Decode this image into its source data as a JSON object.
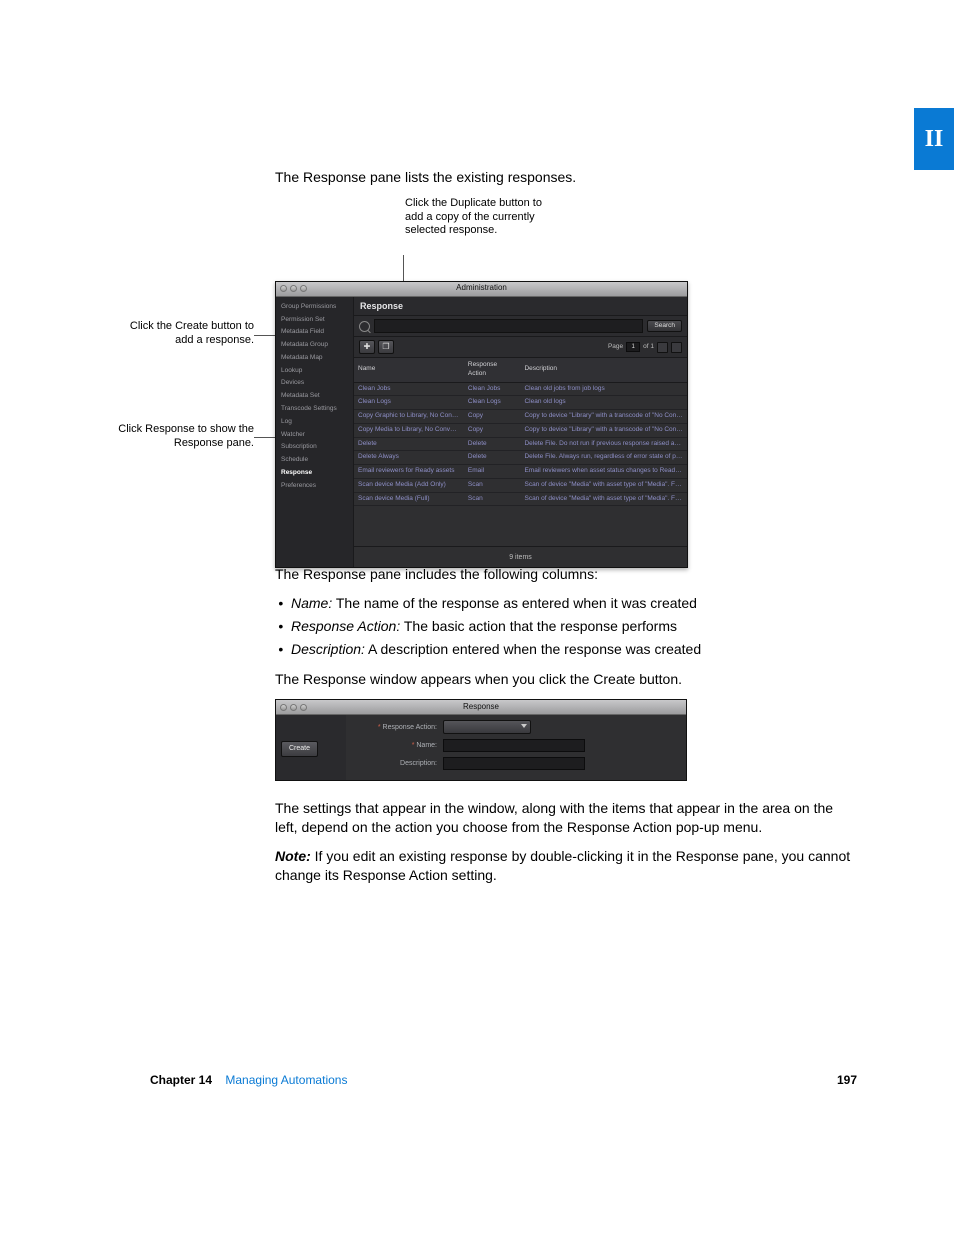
{
  "tab_marker": "II",
  "intro": "The Response pane lists the existing responses.",
  "callouts": {
    "duplicate": "Click the Duplicate button to add a copy of the currently selected response.",
    "create": "Click the Create button to add a response.",
    "response_pane": "Click Response to show the Response pane."
  },
  "admin_window": {
    "title": "Administration",
    "sidebar": {
      "items": [
        "Group Permissions",
        "Permission Set",
        "Metadata Field",
        "Metadata Group",
        "Metadata Map",
        "Lookup",
        "Devices",
        "Metadata Set",
        "Transcode Settings",
        "Log",
        "Watcher",
        "Subscription",
        "Schedule",
        "Response",
        "Preferences"
      ],
      "active": "Response"
    },
    "pane_title": "Response",
    "search_button": "Search",
    "toolbar": {
      "create_icon": "✚",
      "duplicate_icon": "❐"
    },
    "pager": {
      "prefix": "Page",
      "value": "1",
      "suffix": "of 1"
    },
    "columns": [
      "Name",
      "Response Action",
      "Description"
    ],
    "rows": [
      {
        "name": "Clean Jobs",
        "action": "Clean Jobs",
        "desc": "Clean old jobs from job logs"
      },
      {
        "name": "Clean Logs",
        "action": "Clean Logs",
        "desc": "Clean old logs"
      },
      {
        "name": "Copy Graphic to Library, No Conver…",
        "action": "Copy",
        "desc": "Copy to device \"Library\" with a transcode of \"No Conversion…"
      },
      {
        "name": "Copy Media to Library, No Convers…",
        "action": "Copy",
        "desc": "Copy to device \"Library\" with a transcode of \"No Conversion…"
      },
      {
        "name": "Delete",
        "action": "Delete",
        "desc": "Delete File. Do not run if previous response raised an error."
      },
      {
        "name": "Delete Always",
        "action": "Delete",
        "desc": "Delete File. Always run, regardless of error state of previous…"
      },
      {
        "name": "Email reviewers for Ready assets",
        "action": "Email",
        "desc": "Email reviewers when asset status changes to Ready for Rev…"
      },
      {
        "name": "Scan device Media (Add Only)",
        "action": "Scan",
        "desc": "Scan of device \"Media\" with asset type of \"Media\". Features: E…"
      },
      {
        "name": "Scan device Media (Full)",
        "action": "Scan",
        "desc": "Scan of device \"Media\" with asset type of \"Media\". Features: E…"
      }
    ],
    "footer_count": "9 items"
  },
  "body_text": {
    "columns_intro": "The Response pane includes the following columns:",
    "bullets": [
      {
        "term": "Name:",
        "text": "The name of the response as entered when it was created"
      },
      {
        "term": "Response Action:",
        "text": "The basic action that the response performs"
      },
      {
        "term": "Description:",
        "text": "A description entered when the response was created"
      }
    ],
    "create_window": "The Response window appears when you click the Create button.",
    "settings_para": "The settings that appear in the window, along with the items that appear in the area on the left, depend on the action you choose from the Response Action pop-up menu.",
    "note_label": "Note:",
    "note_text": "If you edit an existing response by double-clicking it in the Response pane, you cannot change its Response Action setting."
  },
  "response_dialog": {
    "title": "Response",
    "action_label": "Response Action:",
    "create_button": "Create",
    "name_label": "Name:",
    "name_ast": "*",
    "desc_label": "Description:"
  },
  "footer": {
    "chapter": "Chapter 14",
    "title": "Managing Automations",
    "page": "197"
  }
}
